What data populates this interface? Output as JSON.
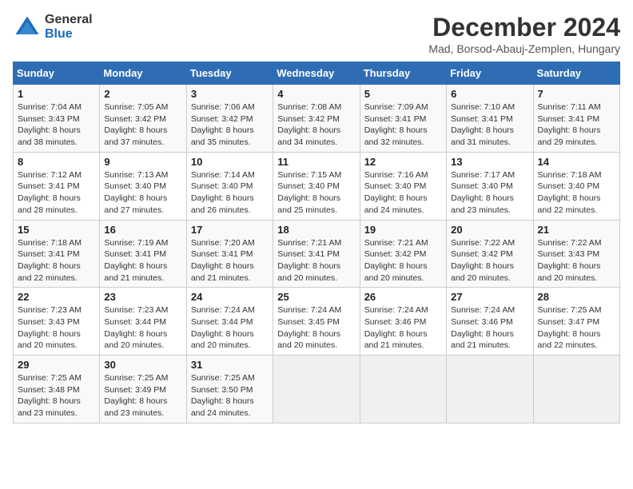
{
  "header": {
    "logo_general": "General",
    "logo_blue": "Blue",
    "month_title": "December 2024",
    "subtitle": "Mad, Borsod-Abauj-Zemplen, Hungary"
  },
  "weekdays": [
    "Sunday",
    "Monday",
    "Tuesday",
    "Wednesday",
    "Thursday",
    "Friday",
    "Saturday"
  ],
  "weeks": [
    [
      {
        "day": "1",
        "sunrise": "7:04 AM",
        "sunset": "3:43 PM",
        "daylight": "8 hours and 38 minutes."
      },
      {
        "day": "2",
        "sunrise": "7:05 AM",
        "sunset": "3:42 PM",
        "daylight": "8 hours and 37 minutes."
      },
      {
        "day": "3",
        "sunrise": "7:06 AM",
        "sunset": "3:42 PM",
        "daylight": "8 hours and 35 minutes."
      },
      {
        "day": "4",
        "sunrise": "7:08 AM",
        "sunset": "3:42 PM",
        "daylight": "8 hours and 34 minutes."
      },
      {
        "day": "5",
        "sunrise": "7:09 AM",
        "sunset": "3:41 PM",
        "daylight": "8 hours and 32 minutes."
      },
      {
        "day": "6",
        "sunrise": "7:10 AM",
        "sunset": "3:41 PM",
        "daylight": "8 hours and 31 minutes."
      },
      {
        "day": "7",
        "sunrise": "7:11 AM",
        "sunset": "3:41 PM",
        "daylight": "8 hours and 29 minutes."
      }
    ],
    [
      {
        "day": "8",
        "sunrise": "7:12 AM",
        "sunset": "3:41 PM",
        "daylight": "8 hours and 28 minutes."
      },
      {
        "day": "9",
        "sunrise": "7:13 AM",
        "sunset": "3:40 PM",
        "daylight": "8 hours and 27 minutes."
      },
      {
        "day": "10",
        "sunrise": "7:14 AM",
        "sunset": "3:40 PM",
        "daylight": "8 hours and 26 minutes."
      },
      {
        "day": "11",
        "sunrise": "7:15 AM",
        "sunset": "3:40 PM",
        "daylight": "8 hours and 25 minutes."
      },
      {
        "day": "12",
        "sunrise": "7:16 AM",
        "sunset": "3:40 PM",
        "daylight": "8 hours and 24 minutes."
      },
      {
        "day": "13",
        "sunrise": "7:17 AM",
        "sunset": "3:40 PM",
        "daylight": "8 hours and 23 minutes."
      },
      {
        "day": "14",
        "sunrise": "7:18 AM",
        "sunset": "3:40 PM",
        "daylight": "8 hours and 22 minutes."
      }
    ],
    [
      {
        "day": "15",
        "sunrise": "7:18 AM",
        "sunset": "3:41 PM",
        "daylight": "8 hours and 22 minutes."
      },
      {
        "day": "16",
        "sunrise": "7:19 AM",
        "sunset": "3:41 PM",
        "daylight": "8 hours and 21 minutes."
      },
      {
        "day": "17",
        "sunrise": "7:20 AM",
        "sunset": "3:41 PM",
        "daylight": "8 hours and 21 minutes."
      },
      {
        "day": "18",
        "sunrise": "7:21 AM",
        "sunset": "3:41 PM",
        "daylight": "8 hours and 20 minutes."
      },
      {
        "day": "19",
        "sunrise": "7:21 AM",
        "sunset": "3:42 PM",
        "daylight": "8 hours and 20 minutes."
      },
      {
        "day": "20",
        "sunrise": "7:22 AM",
        "sunset": "3:42 PM",
        "daylight": "8 hours and 20 minutes."
      },
      {
        "day": "21",
        "sunrise": "7:22 AM",
        "sunset": "3:43 PM",
        "daylight": "8 hours and 20 minutes."
      }
    ],
    [
      {
        "day": "22",
        "sunrise": "7:23 AM",
        "sunset": "3:43 PM",
        "daylight": "8 hours and 20 minutes."
      },
      {
        "day": "23",
        "sunrise": "7:23 AM",
        "sunset": "3:44 PM",
        "daylight": "8 hours and 20 minutes."
      },
      {
        "day": "24",
        "sunrise": "7:24 AM",
        "sunset": "3:44 PM",
        "daylight": "8 hours and 20 minutes."
      },
      {
        "day": "25",
        "sunrise": "7:24 AM",
        "sunset": "3:45 PM",
        "daylight": "8 hours and 20 minutes."
      },
      {
        "day": "26",
        "sunrise": "7:24 AM",
        "sunset": "3:46 PM",
        "daylight": "8 hours and 21 minutes."
      },
      {
        "day": "27",
        "sunrise": "7:24 AM",
        "sunset": "3:46 PM",
        "daylight": "8 hours and 21 minutes."
      },
      {
        "day": "28",
        "sunrise": "7:25 AM",
        "sunset": "3:47 PM",
        "daylight": "8 hours and 22 minutes."
      }
    ],
    [
      {
        "day": "29",
        "sunrise": "7:25 AM",
        "sunset": "3:48 PM",
        "daylight": "8 hours and 23 minutes."
      },
      {
        "day": "30",
        "sunrise": "7:25 AM",
        "sunset": "3:49 PM",
        "daylight": "8 hours and 23 minutes."
      },
      {
        "day": "31",
        "sunrise": "7:25 AM",
        "sunset": "3:50 PM",
        "daylight": "8 hours and 24 minutes."
      },
      null,
      null,
      null,
      null
    ]
  ],
  "labels": {
    "sunrise": "Sunrise: ",
    "sunset": "Sunset: ",
    "daylight": "Daylight: "
  }
}
